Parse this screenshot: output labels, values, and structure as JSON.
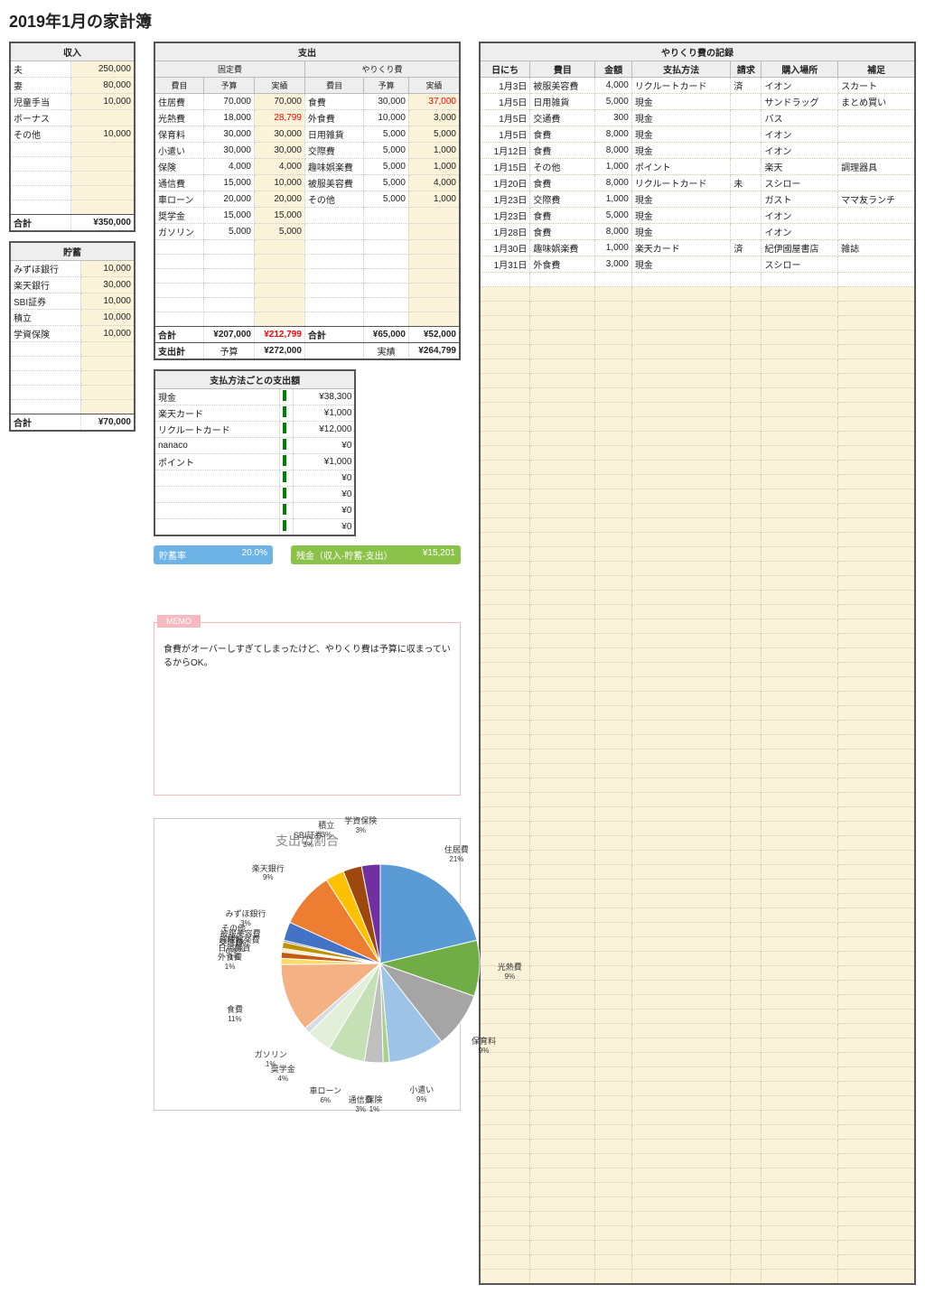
{
  "title": "2019年1月の家計簿",
  "income": {
    "header": "収入",
    "rows": [
      {
        "label": "夫",
        "value": "250,000"
      },
      {
        "label": "妻",
        "value": "80,000"
      },
      {
        "label": "児童手当",
        "value": "10,000"
      },
      {
        "label": "ボーナス",
        "value": ""
      },
      {
        "label": "その他",
        "value": "10,000"
      }
    ],
    "total_label": "合計",
    "total_value": "¥350,000"
  },
  "savings": {
    "header": "貯蓄",
    "rows": [
      {
        "label": "みずほ銀行",
        "value": "10,000"
      },
      {
        "label": "楽天銀行",
        "value": "30,000"
      },
      {
        "label": "SBI証券",
        "value": "10,000"
      },
      {
        "label": "積立",
        "value": "10,000"
      },
      {
        "label": "学資保険",
        "value": "10,000"
      }
    ],
    "total_label": "合計",
    "total_value": "¥70,000"
  },
  "spending": {
    "header": "支出",
    "fixed_header": "固定費",
    "variable_header": "やりくり費",
    "cols": {
      "c1": "費目",
      "c2": "予算",
      "c3": "実績",
      "c4": "費目",
      "c5": "予算",
      "c6": "実績"
    },
    "rows": [
      {
        "l": "住居費",
        "b": "70,000",
        "a": "70,000",
        "r": "食費",
        "rb": "30,000",
        "ra": "37,000",
        "ra_red": true
      },
      {
        "l": "光熱費",
        "b": "18,000",
        "a": "28,799",
        "a_red": true,
        "r": "外食費",
        "rb": "10,000",
        "ra": "3,000"
      },
      {
        "l": "保育料",
        "b": "30,000",
        "a": "30,000",
        "r": "日用雑貨",
        "rb": "5,000",
        "ra": "5,000"
      },
      {
        "l": "小遣い",
        "b": "30,000",
        "a": "30,000",
        "r": "交際費",
        "rb": "5,000",
        "ra": "1,000"
      },
      {
        "l": "保険",
        "b": "4,000",
        "a": "4,000",
        "r": "趣味娯楽費",
        "rb": "5,000",
        "ra": "1,000"
      },
      {
        "l": "通信費",
        "b": "15,000",
        "a": "10,000",
        "r": "被服美容費",
        "rb": "5,000",
        "ra": "4,000"
      },
      {
        "l": "車ローン",
        "b": "20,000",
        "a": "20,000",
        "r": "その他",
        "rb": "5,000",
        "ra": "1,000"
      },
      {
        "l": "奨学金",
        "b": "15,000",
        "a": "15,000",
        "r": "",
        "rb": "",
        "ra": ""
      },
      {
        "l": "ガソリン",
        "b": "5,000",
        "a": "5,000",
        "r": "",
        "rb": "",
        "ra": ""
      }
    ],
    "sub_total_l": "合計",
    "sub_bl": "¥207,000",
    "sub_al": "¥212,799",
    "sub_al_red": true,
    "sub_total_r": "合計",
    "sub_br": "¥65,000",
    "sub_ar": "¥52,000",
    "grand_label": "支出計",
    "grand_budget_l": "予算",
    "grand_budget": "¥272,000",
    "grand_actual_l": "実績",
    "grand_actual": "¥264,799"
  },
  "by_method": {
    "header": "支払方法ごとの支出額",
    "rows": [
      {
        "l": "現金",
        "v": "¥38,300"
      },
      {
        "l": "楽天カード",
        "v": "¥1,000"
      },
      {
        "l": "リクルートカード",
        "v": "¥12,000"
      },
      {
        "l": "nanaco",
        "v": "¥0"
      },
      {
        "l": "ポイント",
        "v": "¥1,000"
      },
      {
        "l": "",
        "v": "¥0"
      },
      {
        "l": "",
        "v": "¥0"
      },
      {
        "l": "",
        "v": "¥0"
      },
      {
        "l": "",
        "v": "¥0"
      }
    ]
  },
  "rate": {
    "label": "貯蓄率",
    "value": "20.0%"
  },
  "remain": {
    "label": "残金（収入-貯蓄-支出）",
    "value": "¥15,201"
  },
  "memo": {
    "tag": "MEMO",
    "text": "食費がオーバーしすぎてしまったけど、やりくり費は予算に収まっているからOK。"
  },
  "log": {
    "header": "やりくり費の記録",
    "cols": {
      "c1": "日にち",
      "c2": "費目",
      "c3": "金額",
      "c4": "支払方法",
      "c5": "請求",
      "c6": "購入場所",
      "c7": "補足"
    },
    "rows": [
      {
        "d": "1月3日",
        "cat": "被服美容費",
        "amt": "4,000",
        "m": "リクルートカード",
        "req": "済",
        "shop": "イオン",
        "note": "スカート"
      },
      {
        "d": "1月5日",
        "cat": "日用雑貨",
        "amt": "5,000",
        "m": "現金",
        "req": "",
        "shop": "サンドラッグ",
        "note": "まとめ買い"
      },
      {
        "d": "1月5日",
        "cat": "交通費",
        "amt": "300",
        "m": "現金",
        "req": "",
        "shop": "バス",
        "note": ""
      },
      {
        "d": "1月5日",
        "cat": "食費",
        "amt": "8,000",
        "m": "現金",
        "req": "",
        "shop": "イオン",
        "note": ""
      },
      {
        "d": "1月12日",
        "cat": "食費",
        "amt": "8,000",
        "m": "現金",
        "req": "",
        "shop": "イオン",
        "note": ""
      },
      {
        "d": "1月15日",
        "cat": "その他",
        "amt": "1,000",
        "m": "ポイント",
        "req": "",
        "shop": "楽天",
        "note": "調理器具"
      },
      {
        "d": "1月20日",
        "cat": "食費",
        "amt": "8,000",
        "m": "リクルートカード",
        "req": "未",
        "shop": "スシロー",
        "note": ""
      },
      {
        "d": "1月23日",
        "cat": "交際費",
        "amt": "1,000",
        "m": "現金",
        "req": "",
        "shop": "ガスト",
        "note": "ママ友ランチ"
      },
      {
        "d": "1月23日",
        "cat": "食費",
        "amt": "5,000",
        "m": "現金",
        "req": "",
        "shop": "イオン",
        "note": ""
      },
      {
        "d": "1月28日",
        "cat": "食費",
        "amt": "8,000",
        "m": "現金",
        "req": "",
        "shop": "イオン",
        "note": ""
      },
      {
        "d": "1月30日",
        "cat": "趣味娯楽費",
        "amt": "1,000",
        "m": "楽天カード",
        "req": "済",
        "shop": "紀伊國屋書店",
        "note": "雑誌"
      },
      {
        "d": "1月31日",
        "cat": "外食費",
        "amt": "3,000",
        "m": "現金",
        "req": "",
        "shop": "スシロー",
        "note": ""
      }
    ]
  },
  "chart_data": {
    "type": "pie",
    "title": "支出の割合",
    "series": [
      {
        "name": "住居費",
        "value": 21
      },
      {
        "name": "光熱費",
        "value": 9
      },
      {
        "name": "保育料",
        "value": 9
      },
      {
        "name": "小遣い",
        "value": 9
      },
      {
        "name": "保険",
        "value": 1
      },
      {
        "name": "通信費",
        "value": 3
      },
      {
        "name": "車ローン",
        "value": 6
      },
      {
        "name": "奨学金",
        "value": 4
      },
      {
        "name": "ガソリン",
        "value": 1
      },
      {
        "name": "食費",
        "value": 11
      },
      {
        "name": "外食費",
        "value": 1
      },
      {
        "name": "日用雑貨",
        "value": 1
      },
      {
        "name": "交際費",
        "value": 0
      },
      {
        "name": "趣味娯楽費",
        "value": 0
      },
      {
        "name": "被服美容費",
        "value": 1
      },
      {
        "name": "その他",
        "value": 0
      },
      {
        "name": "みずほ銀行",
        "value": 3
      },
      {
        "name": "楽天銀行",
        "value": 9
      },
      {
        "name": "SBI証券",
        "value": 3
      },
      {
        "name": "積立",
        "value": 3
      },
      {
        "name": "学資保険",
        "value": 3
      }
    ]
  }
}
